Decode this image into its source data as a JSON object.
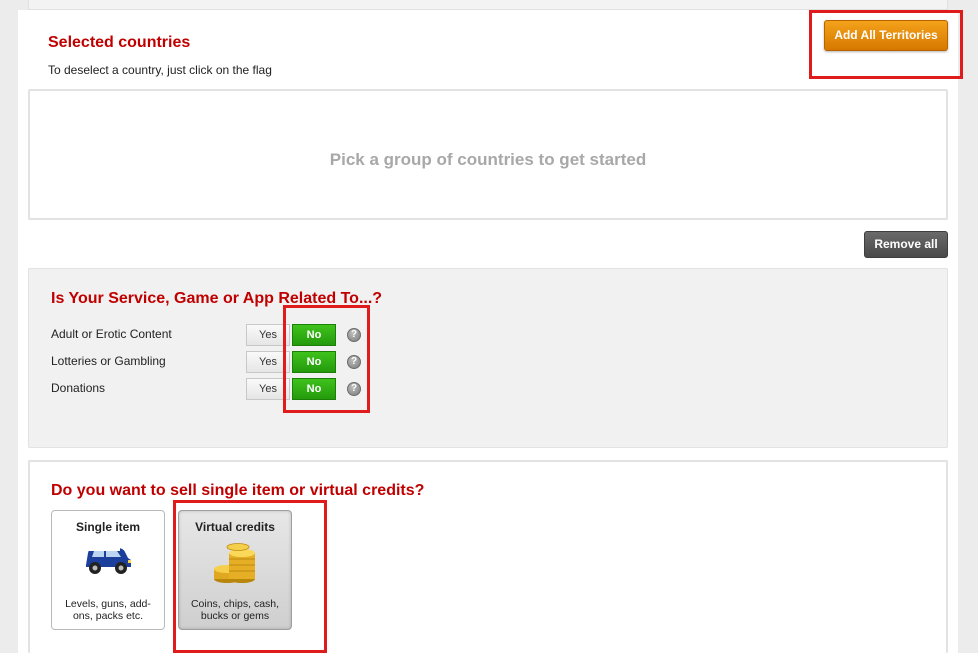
{
  "countries": {
    "title": "Selected countries",
    "hint": "To deselect a country, just click on the flag",
    "add_all_label": "Add All Territories",
    "empty_text": "Pick a group of countries to get started",
    "remove_all_label": "Remove all"
  },
  "related": {
    "title": "Is Your Service, Game or App Related To...?",
    "rows": [
      {
        "label": "Adult or Erotic Content",
        "yes": "Yes",
        "no": "No",
        "help": "?"
      },
      {
        "label": "Lotteries or Gambling",
        "yes": "Yes",
        "no": "No",
        "help": "?"
      },
      {
        "label": "Donations",
        "yes": "Yes",
        "no": "No",
        "help": "?"
      }
    ]
  },
  "sell": {
    "title": "Do you want to sell single item or virtual credits?",
    "options": [
      {
        "title": "Single item",
        "desc": "Levels, guns, add-ons, packs etc.",
        "icon": "car-icon"
      },
      {
        "title": "Virtual credits",
        "desc": "Coins, chips, cash, bucks or gems",
        "icon": "coins-icon"
      }
    ]
  },
  "colors": {
    "accent_red": "#c00000",
    "orange_button": "#e88a0c",
    "green_selected": "#2faa12",
    "highlight_box": "#e01b1b"
  }
}
